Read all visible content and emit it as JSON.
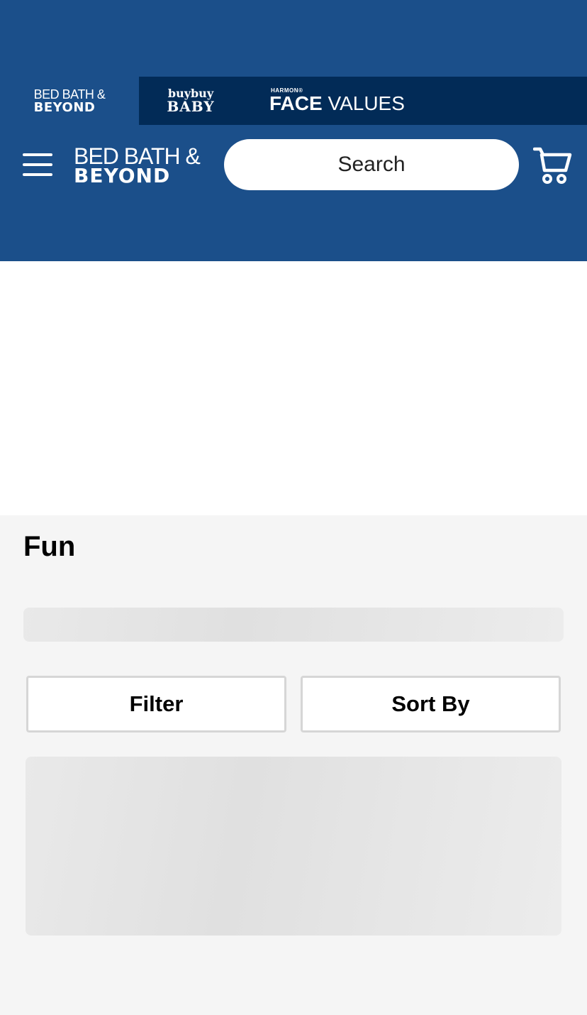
{
  "brands": [
    {
      "top": "BED BATH &",
      "bottom": "BEYOND"
    },
    {
      "top": "buybuy",
      "bottom": "BABY"
    },
    {
      "top": "HARMON®",
      "bottom_bold": "FACE",
      "bottom_light": "VALUES"
    }
  ],
  "header": {
    "logo_top": "BED BATH &",
    "logo_bottom": "BEYOND",
    "search_placeholder": "Search",
    "menu_icon": "hamburger-menu-icon",
    "cart_icon": "shopping-cart-icon"
  },
  "page": {
    "title": "Fun"
  },
  "controls": {
    "filter_label": "Filter",
    "sort_label": "Sort By"
  },
  "colors": {
    "header_blue": "#1b4f8a",
    "brand_bar_navy": "#022b57",
    "background": "#f5f5f5",
    "skeleton": "#e6e6e6"
  }
}
